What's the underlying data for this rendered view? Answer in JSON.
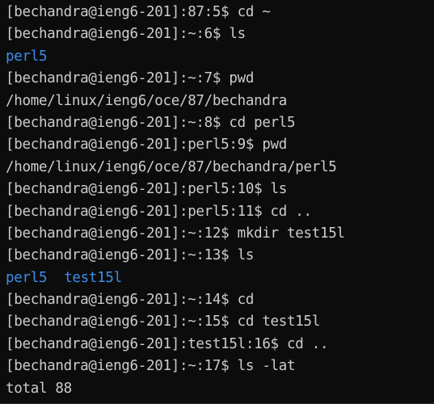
{
  "colors": {
    "background": "#0c0c0c",
    "text": "#cccccc",
    "directory": "#3b8eea"
  },
  "terminal": {
    "lines": [
      {
        "type": "command",
        "text": "[bechandra@ieng6-201]:87:5$ cd ~"
      },
      {
        "type": "command",
        "text": "[bechandra@ieng6-201]:~:6$ ls"
      },
      {
        "type": "dirs",
        "items": [
          "perl5"
        ]
      },
      {
        "type": "command",
        "text": "[bechandra@ieng6-201]:~:7$ pwd"
      },
      {
        "type": "output",
        "text": "/home/linux/ieng6/oce/87/bechandra"
      },
      {
        "type": "command",
        "text": "[bechandra@ieng6-201]:~:8$ cd perl5"
      },
      {
        "type": "command",
        "text": "[bechandra@ieng6-201]:perl5:9$ pwd"
      },
      {
        "type": "output",
        "text": "/home/linux/ieng6/oce/87/bechandra/perl5"
      },
      {
        "type": "command",
        "text": "[bechandra@ieng6-201]:perl5:10$ ls"
      },
      {
        "type": "command",
        "text": "[bechandra@ieng6-201]:perl5:11$ cd .."
      },
      {
        "type": "command",
        "text": "[bechandra@ieng6-201]:~:12$ mkdir test15l"
      },
      {
        "type": "command",
        "text": "[bechandra@ieng6-201]:~:13$ ls"
      },
      {
        "type": "dirs",
        "items": [
          "perl5",
          "test15l"
        ]
      },
      {
        "type": "command",
        "text": "[bechandra@ieng6-201]:~:14$ cd"
      },
      {
        "type": "command",
        "text": "[bechandra@ieng6-201]:~:15$ cd test15l"
      },
      {
        "type": "command",
        "text": "[bechandra@ieng6-201]:test15l:16$ cd .."
      },
      {
        "type": "command",
        "text": "[bechandra@ieng6-201]:~:17$ ls -lat"
      },
      {
        "type": "output",
        "text": "total 88"
      }
    ]
  }
}
